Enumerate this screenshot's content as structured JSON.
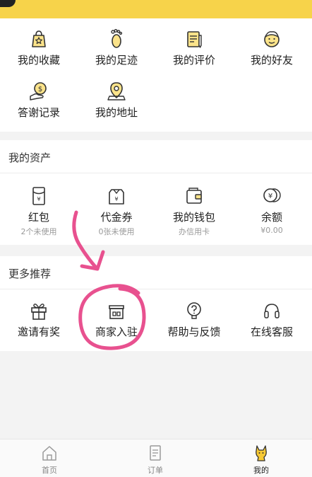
{
  "colors": {
    "brand_yellow": "#f7d34a",
    "annotation_pink": "#e8518f",
    "icon_stroke": "#333333",
    "muted_text": "#999999"
  },
  "top_grid": [
    {
      "label": "我的收藏",
      "icon": "favorites-bag-icon"
    },
    {
      "label": "我的足迹",
      "icon": "footprint-icon"
    },
    {
      "label": "我的评价",
      "icon": "review-notes-icon"
    },
    {
      "label": "我的好友",
      "icon": "friend-face-icon"
    },
    {
      "label": "答谢记录",
      "icon": "thanks-coin-hand-icon"
    },
    {
      "label": "我的地址",
      "icon": "address-pin-icon"
    }
  ],
  "assets": {
    "title": "我的资产",
    "items": [
      {
        "label": "红包",
        "sub": "2个未使用",
        "icon": "red-packet-icon"
      },
      {
        "label": "代金券",
        "sub": "0张未使用",
        "icon": "voucher-icon"
      },
      {
        "label": "我的钱包",
        "sub": "办信用卡",
        "icon": "wallet-icon"
      },
      {
        "label": "余额",
        "sub": "¥0.00",
        "icon": "balance-coin-icon"
      }
    ]
  },
  "recommend": {
    "title": "更多推荐",
    "items": [
      {
        "label": "邀请有奖",
        "icon": "gift-icon"
      },
      {
        "label": "商家入驻",
        "icon": "storefront-icon"
      },
      {
        "label": "帮助与反馈",
        "icon": "help-icon"
      },
      {
        "label": "在线客服",
        "icon": "headset-icon"
      }
    ]
  },
  "tabbar": [
    {
      "label": "首页",
      "icon": "home-icon"
    },
    {
      "label": "订单",
      "icon": "order-icon"
    },
    {
      "label": "我的",
      "icon": "kangaroo-icon",
      "active": true
    }
  ]
}
